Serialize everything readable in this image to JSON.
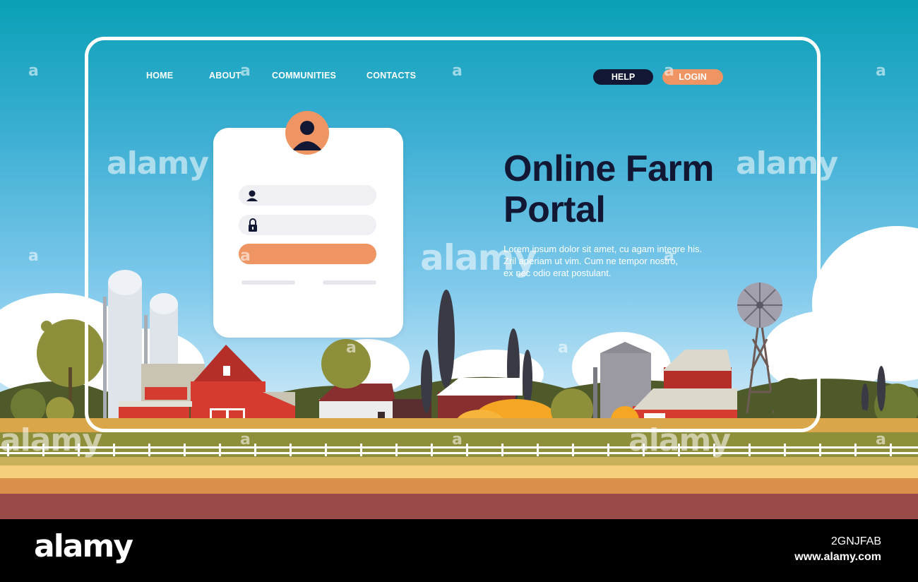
{
  "nav": {
    "items": [
      {
        "label": "HOME"
      },
      {
        "label": "ABOUT"
      },
      {
        "label": "COMMUNITIES"
      },
      {
        "label": "CONTACTS"
      }
    ],
    "help_label": "HELP",
    "login_label": "LOGIN"
  },
  "hero": {
    "title_line1": "Online Farm",
    "title_line2": "Portal",
    "desc_line1": "Lorem ipsum dolor sit amet, cu agam integre his.",
    "desc_line2": "Zril aperiam ut vim. Cum ne tempor nostro,",
    "desc_line3": "ex nec odio erat postulant."
  },
  "login_form": {
    "username_icon": "user-icon",
    "password_icon": "lock-icon",
    "avatar_icon": "avatar-icon"
  },
  "watermark": {
    "text": "alamy",
    "small": "a"
  },
  "footer": {
    "logo": "alamy",
    "image_id": "2GNJFAB",
    "site": "www.alamy.com"
  },
  "colors": {
    "accent": "#ee9563",
    "dark": "#121833",
    "sky": "#3aaed2",
    "barn": "#d63b32"
  }
}
